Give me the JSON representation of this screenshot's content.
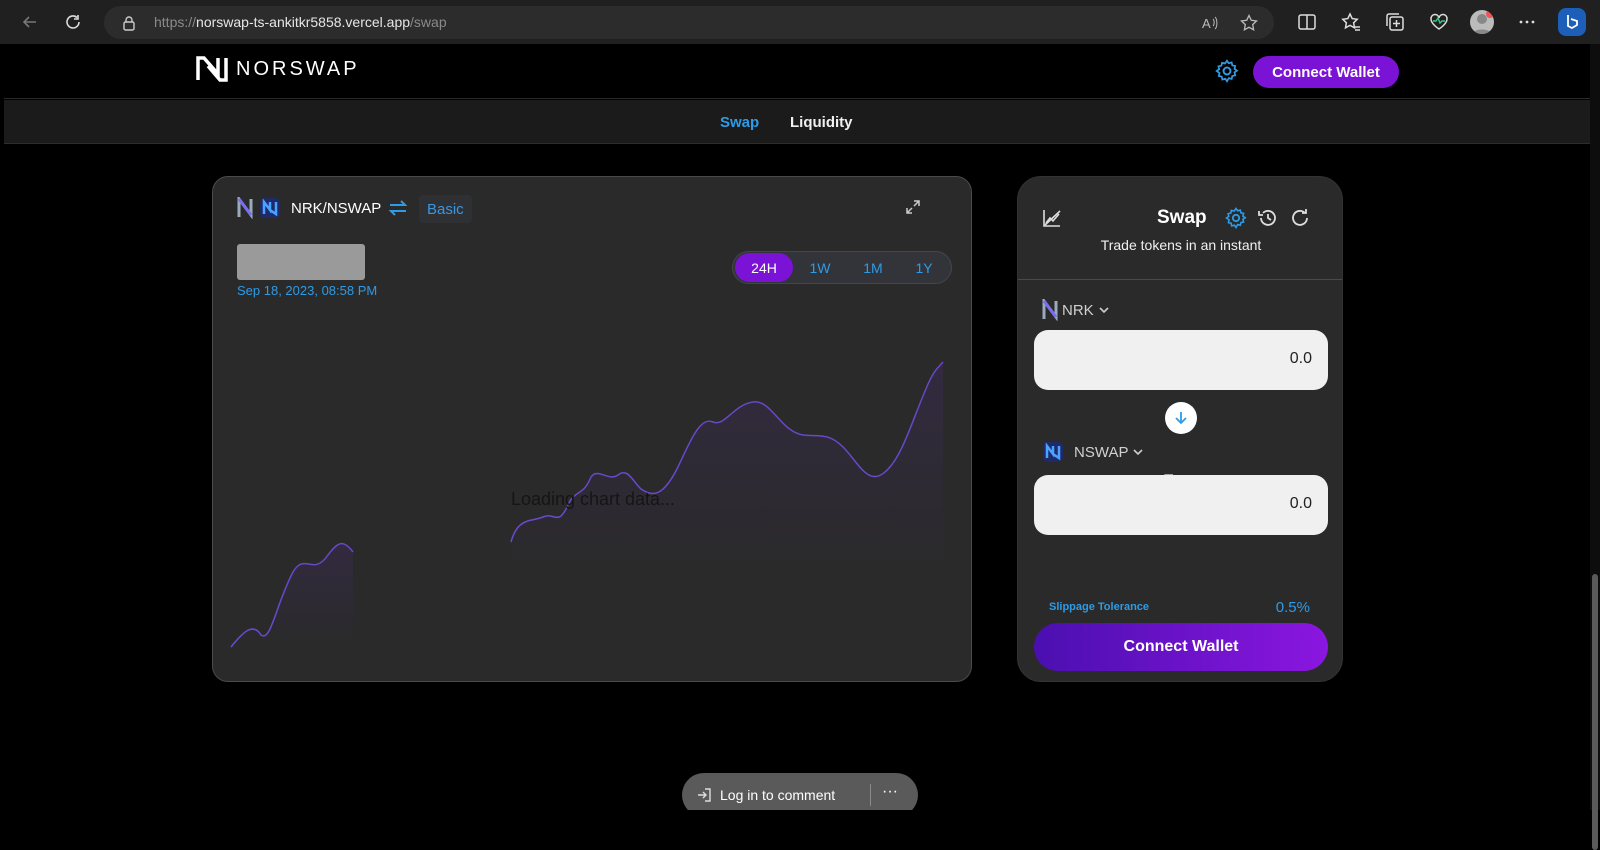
{
  "browser": {
    "url_host": "norswap-ts-ankitkr5858.vercel.app",
    "url_prefix": "https://",
    "url_path": "/swap"
  },
  "header": {
    "logo_text": "NORSWAP",
    "connect_label": "Connect Wallet"
  },
  "subnav": {
    "tabs": [
      {
        "label": "Swap",
        "active": true
      },
      {
        "label": "Liquidity",
        "active": false
      }
    ]
  },
  "chart": {
    "pair": "NRK/NSWAP",
    "mode_label": "Basic",
    "date": "Sep 18, 2023, 08:58 PM",
    "ranges": [
      "24H",
      "1W",
      "1M",
      "1Y"
    ],
    "active_range": "24H",
    "loading_text": "Loading chart data..."
  },
  "swap": {
    "title": "Swap",
    "subtitle": "Trade tokens in an instant",
    "from_token": "NRK",
    "from_amount": "0.0",
    "to_token": "NSWAP",
    "to_amount": "0.0",
    "slippage_label": "Slippage Tolerance",
    "slippage_value": "0.5%",
    "connect_label": "Connect Wallet"
  },
  "comment": {
    "login_label": "Log in to comment",
    "more_label": "···"
  },
  "colors": {
    "accent_purple": "#7a13d6",
    "accent_blue": "#2e9be6"
  }
}
